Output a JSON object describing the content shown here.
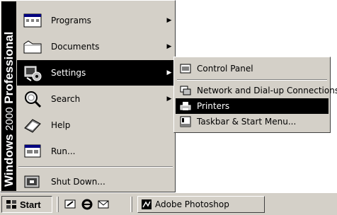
{
  "banner": {
    "brand": "Windows",
    "version": "2000",
    "edition": "Professional"
  },
  "start_menu": {
    "items": [
      {
        "label": "Programs",
        "icon": "programs-icon",
        "submenu_arrow": "▶"
      },
      {
        "label": "Documents",
        "icon": "documents-icon",
        "submenu_arrow": "▶"
      },
      {
        "label": "Settings",
        "icon": "settings-icon",
        "submenu_arrow": "▶",
        "active": true
      },
      {
        "label": "Search",
        "icon": "search-icon",
        "submenu_arrow": "▶"
      },
      {
        "label": "Help",
        "icon": "help-icon"
      },
      {
        "label": "Run...",
        "icon": "run-icon"
      },
      {
        "label": "Shut Down...",
        "icon": "shutdown-icon"
      }
    ]
  },
  "settings_submenu": {
    "items": [
      {
        "label": "Control Panel",
        "icon": "control-panel-icon"
      },
      {
        "label": "Network and Dial-up Connections",
        "icon": "network-icon"
      },
      {
        "label": "Printers",
        "icon": "printer-icon",
        "active": true
      },
      {
        "label": "Taskbar & Start Menu...",
        "icon": "taskbar-icon"
      }
    ]
  },
  "taskbar": {
    "start_label": "Start",
    "quick_launch": [
      "show-desktop-icon",
      "internet-explorer-icon",
      "outlook-express-icon"
    ],
    "tasks": [
      {
        "label": "Adobe Photoshop",
        "icon": "photoshop-icon"
      }
    ]
  },
  "colors": {
    "menu_face": "#d4d0c8",
    "highlight": "#000000",
    "highlight_text": "#ffffff",
    "banner": "#000000"
  }
}
